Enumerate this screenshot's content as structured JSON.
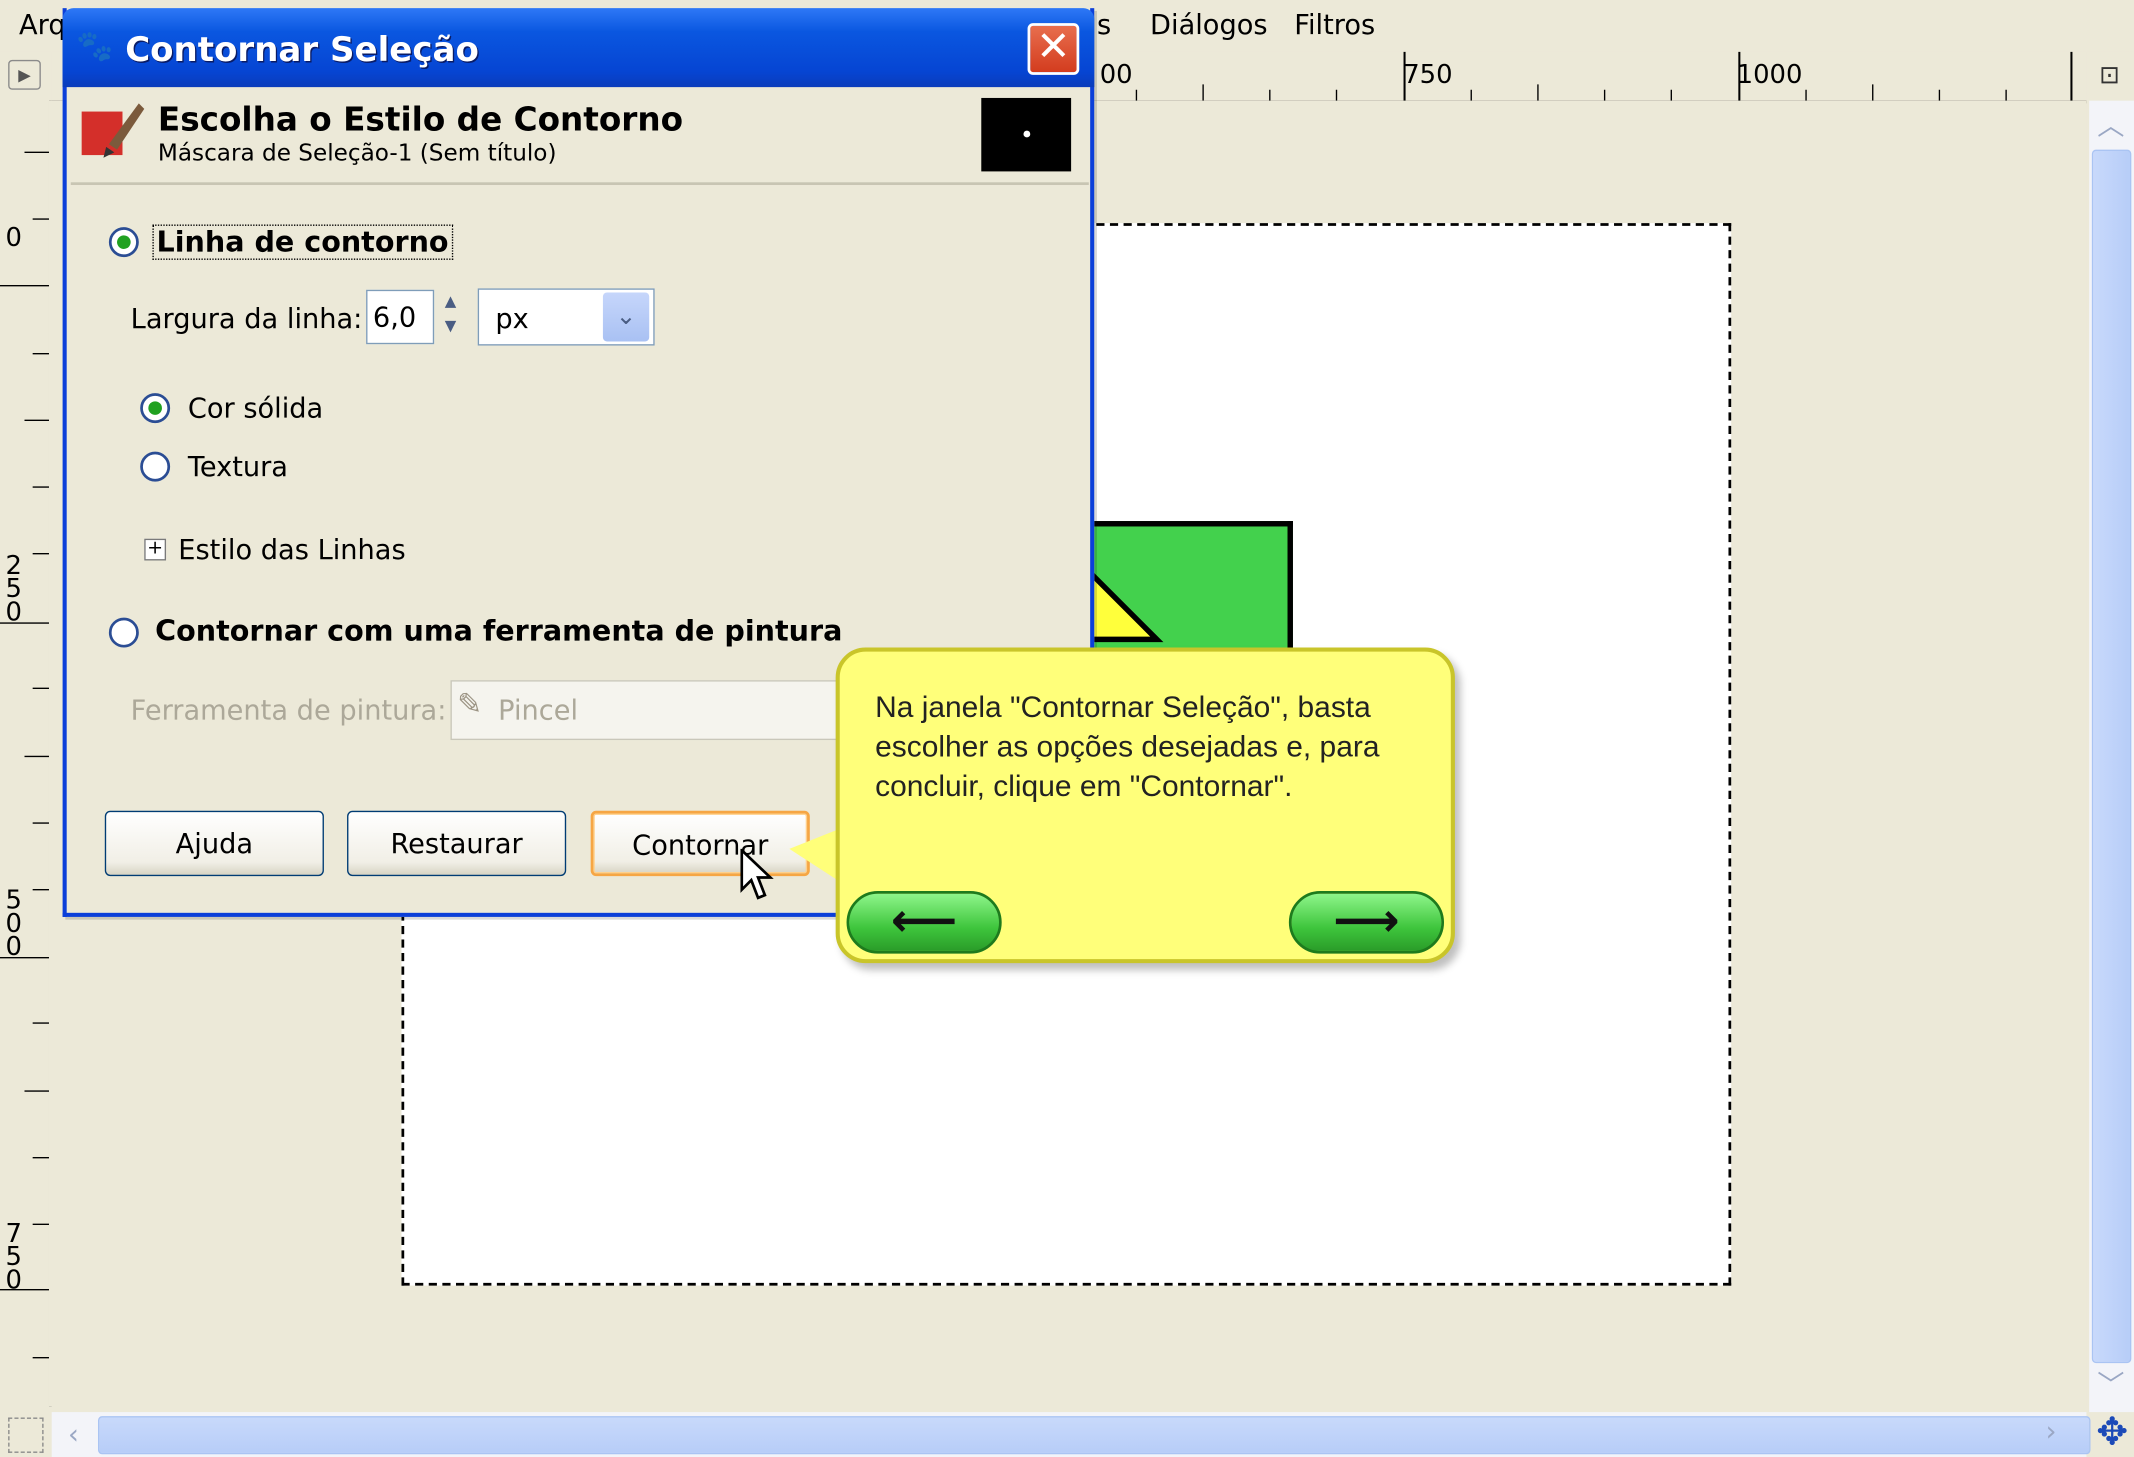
{
  "menubar": {
    "items": [
      "Arq",
      "s",
      "Diálogos",
      "Filtros"
    ]
  },
  "ruler": {
    "h_labels": [
      "00",
      "750",
      "1000"
    ],
    "v_labels": [
      "0",
      "250",
      "500",
      "750"
    ]
  },
  "dialog": {
    "title": "Contornar Seleção",
    "header_title": "Escolha o Estilo de Contorno",
    "header_subtitle": "Máscara de Seleção-1 (Sem título)",
    "option_stroke_line": "Linha de contorno",
    "line_width_label": "Largura da linha:",
    "line_width_value": "6,0",
    "unit_value": "px",
    "solid_color": "Cor sólida",
    "pattern": "Textura",
    "line_style": "Estilo das Linhas",
    "option_paint_tool": "Contornar com uma ferramenta de pintura",
    "paint_tool_label": "Ferramenta de pintura:",
    "paint_tool_value": "Pincel",
    "buttons": {
      "help": "Ajuda",
      "reset": "Restaurar",
      "stroke": "Contornar"
    }
  },
  "callout": {
    "text": "Na janela \"Contornar Seleção\", basta escolher as opções desejadas e, para concluir, clique em \"Contornar\".",
    "back_icon": "arrow-left-icon",
    "next_icon": "arrow-right-icon"
  },
  "colors": {
    "titlebar": "#0645d3",
    "callout_bg": "#ffff7a",
    "nav_green": "#3ec53c",
    "shape_green": "#43d14d"
  }
}
